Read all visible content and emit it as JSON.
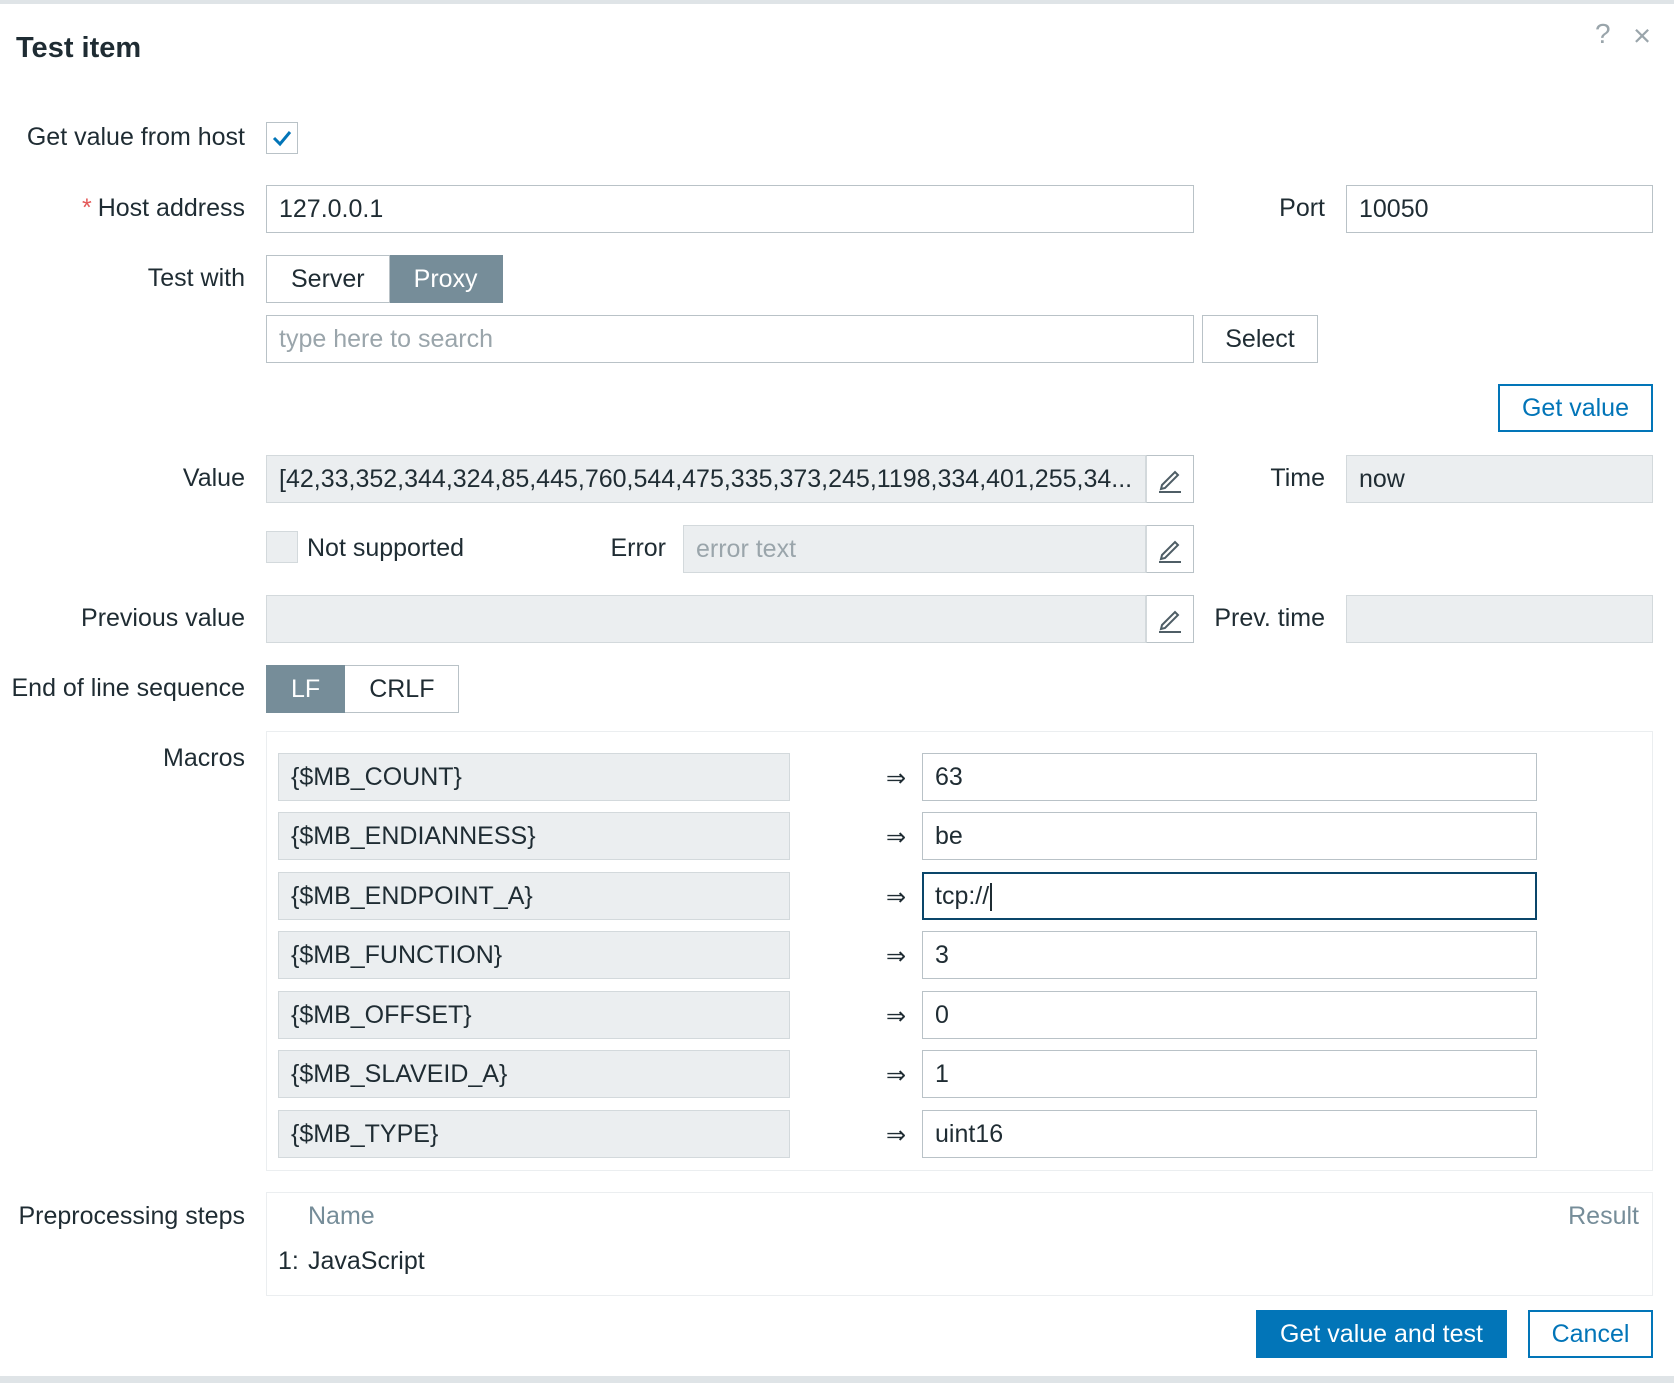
{
  "dialog": {
    "title": "Test item",
    "help_icon": "?",
    "close_icon": "×"
  },
  "form": {
    "get_value_from_host": {
      "label": "Get value from host",
      "checked": true
    },
    "host_address": {
      "label": "Host address",
      "required_mark": "*",
      "value": "127.0.0.1"
    },
    "port": {
      "label": "Port",
      "value": "10050"
    },
    "test_with": {
      "label": "Test with",
      "options": [
        "Server",
        "Proxy"
      ],
      "selected": "Proxy"
    },
    "proxy_search": {
      "placeholder": "type here to search",
      "select_label": "Select"
    },
    "get_value_button": "Get value",
    "value": {
      "label": "Value",
      "text": "[42,33,352,344,324,85,445,760,544,475,335,373,245,1198,334,401,255,34..."
    },
    "time": {
      "label": "Time",
      "value": "now"
    },
    "not_supported": {
      "label": "Not supported",
      "checked": false
    },
    "error": {
      "label": "Error",
      "placeholder": "error text"
    },
    "previous_value": {
      "label": "Previous value",
      "value": ""
    },
    "prev_time": {
      "label": "Prev. time",
      "value": ""
    },
    "eol": {
      "label": "End of line sequence",
      "options": [
        "LF",
        "CRLF"
      ],
      "selected": "LF"
    }
  },
  "macros": {
    "label": "Macros",
    "arrow": "⇒",
    "items": [
      {
        "name": "{$MB_COUNT}",
        "value": "63"
      },
      {
        "name": "{$MB_ENDIANNESS}",
        "value": "be"
      },
      {
        "name": "{$MB_ENDPOINT_A}",
        "value": "tcp://",
        "focused": true
      },
      {
        "name": "{$MB_FUNCTION}",
        "value": "3"
      },
      {
        "name": "{$MB_OFFSET}",
        "value": "0"
      },
      {
        "name": "{$MB_SLAVEID_A}",
        "value": "1"
      },
      {
        "name": "{$MB_TYPE}",
        "value": "uint16"
      }
    ]
  },
  "preprocessing": {
    "label": "Preprocessing steps",
    "col_name": "Name",
    "col_result": "Result",
    "steps": [
      {
        "num": "1:",
        "name": "JavaScript"
      }
    ]
  },
  "footer": {
    "test_button": "Get value and test",
    "cancel_button": "Cancel"
  },
  "colors": {
    "accent": "#0275b8",
    "toggle_on": "#768d99",
    "readonly_bg": "#ebeef0"
  }
}
